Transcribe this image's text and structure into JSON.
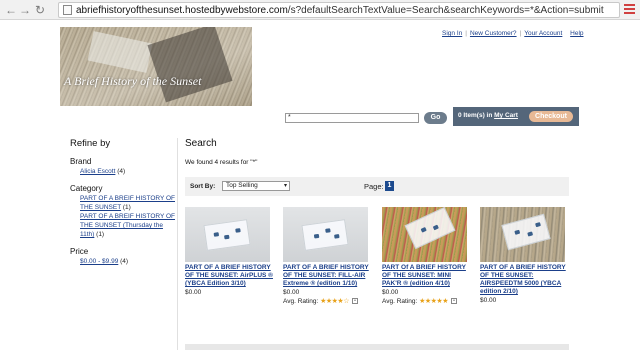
{
  "browser": {
    "url_domain": "abriefhistoryofthesunset.hostedbywebstore.com",
    "url_path": "/s?defaultSearchTextValue=Search&searchKeywords=*&Action=submit"
  },
  "banner": {
    "title": "A Brief History of the Sunset"
  },
  "top_links": {
    "sign_in": "Sign In",
    "new_customer": "New Customer?",
    "your_account": "Your Account",
    "help": "Help"
  },
  "search": {
    "value": "*",
    "go_label": "Go"
  },
  "cart": {
    "count_text": "0 Item(s) in",
    "link": "My Cart",
    "checkout_label": "Checkout"
  },
  "refine": {
    "title": "Refine by",
    "brand_title": "Brand",
    "brand_items": [
      {
        "label": "Alicia Escott",
        "count": "(4)"
      }
    ],
    "category_title": "Category",
    "category_items": [
      {
        "label": "PART OF A BREIF HISTORY OF THE SUNSET",
        "count": "(1)"
      },
      {
        "label": "PART OF A BREIF HISTORY OF THE SUNSET (Thursday the 11th)",
        "count": "(1)"
      }
    ],
    "price_title": "Price",
    "price_items": [
      {
        "label": "$0.00 - $9.99",
        "count": "(4)"
      }
    ]
  },
  "main": {
    "title": "Search",
    "results_message": "We found 4 results for \"*\"",
    "sort_label": "Sort By:",
    "sort_value": "Top Selling",
    "page_label": "Page:",
    "page_number": "1"
  },
  "products": [
    {
      "name": "PART OF A BRIEF HISTORY OF THE SUNSET: AirPLUS ® (YBCA Edition 3/10)",
      "price": "$0.00",
      "rating_label": "",
      "stars": 0
    },
    {
      "name": "PART OF A BRIEF HISTORY OF THE SUNSET: FILL-AIR Extreme ® (edition 1/10)",
      "price": "$0.00",
      "rating_label": "Avg. Rating:",
      "stars": 4
    },
    {
      "name": "PART Of A BRIEF HISTORY OF THE SUNSET: MINI PAK'R ® (edition 4/10)",
      "price": "$0.00",
      "rating_label": "Avg. Rating:",
      "stars": 5
    },
    {
      "name": "PART OF A BRIEF HISTORY OF THE SUNSET: AIRSPEEDTM 5000 (YBCA edition 2/10)",
      "price": "$0.00",
      "rating_label": "",
      "stars": 0
    }
  ]
}
